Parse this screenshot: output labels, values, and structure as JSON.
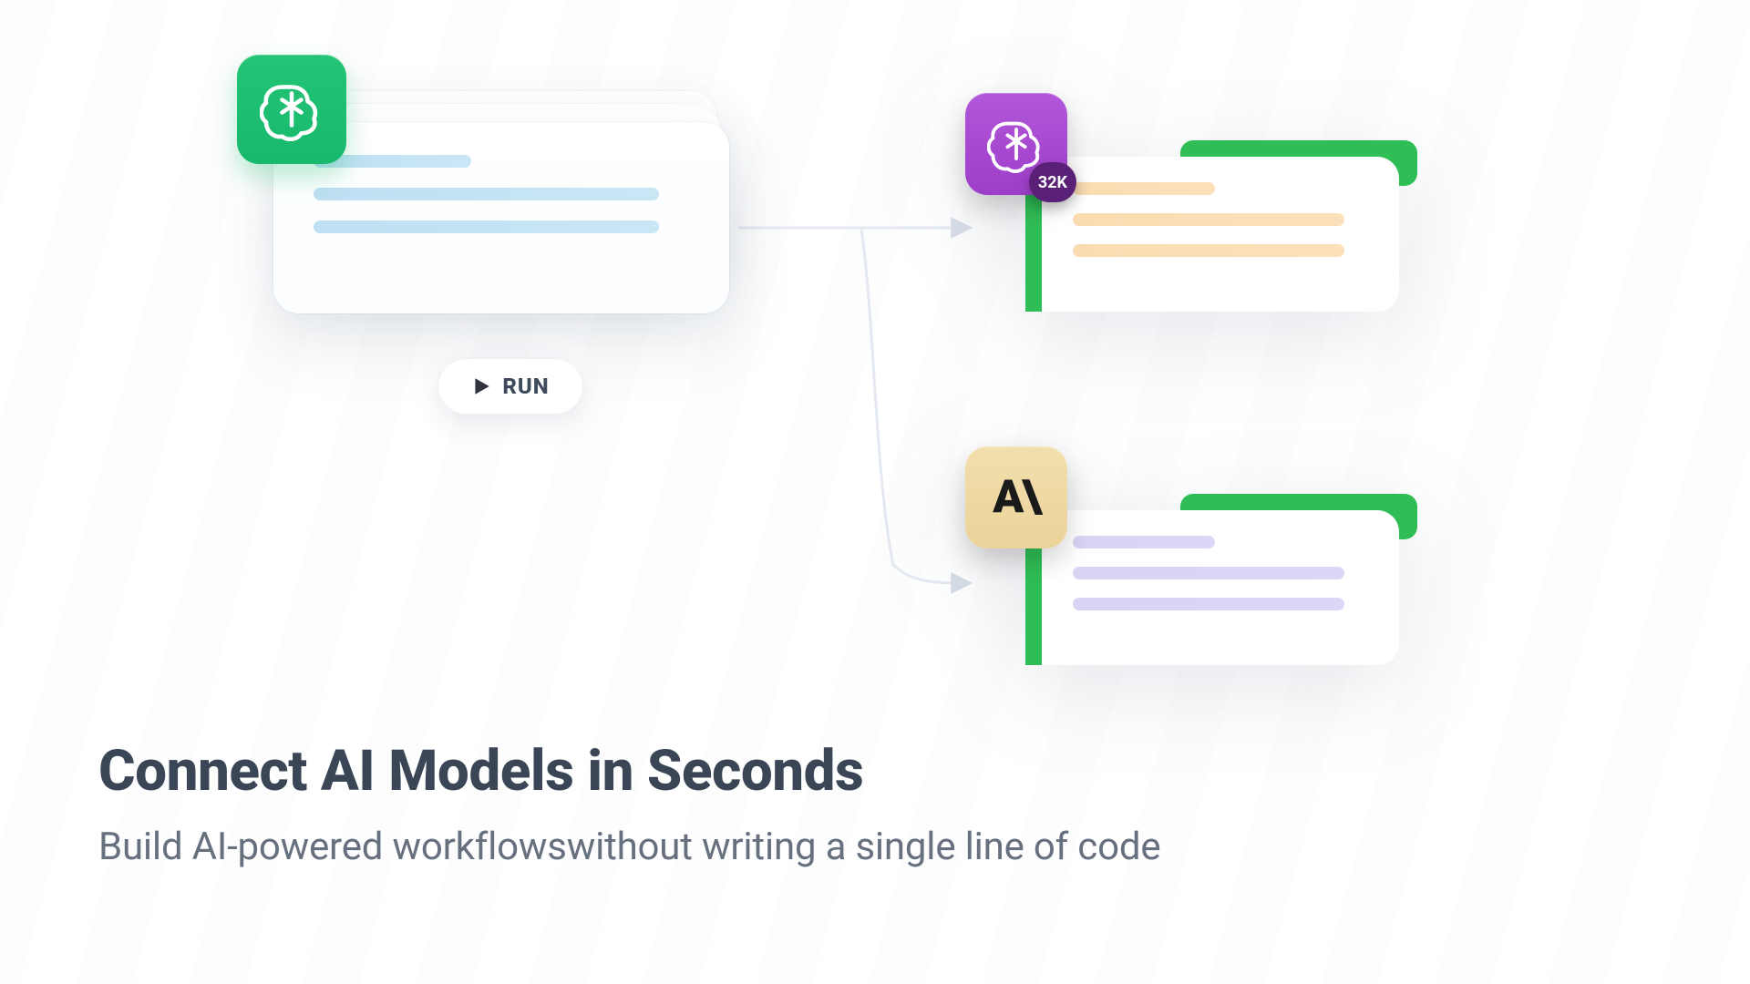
{
  "controls": {
    "run_label": "RUN"
  },
  "nodes": {
    "source": {
      "icon_name": "openai-knot-green"
    },
    "output_top": {
      "icon_name": "openai-knot-purple",
      "badge": "32K"
    },
    "output_bottom": {
      "icon_name": "anthropic-logo",
      "logo_text": "A\\"
    }
  },
  "headline": {
    "title": "Connect AI Models in Seconds",
    "subtitle": "Build AI-powered workflowswithout writing a single line of code"
  }
}
